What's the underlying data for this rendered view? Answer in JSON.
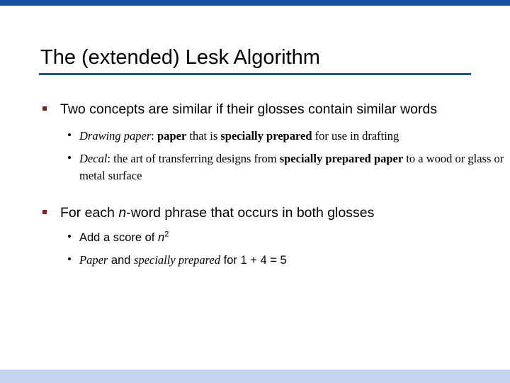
{
  "slide": {
    "title": "The (extended) Lesk Algorithm",
    "accent_color": "#14509E",
    "rule_color": "#1F5287",
    "bullet_marker_color": "#7B2222",
    "footer_band_color": "#C5D5EF"
  },
  "bullets": {
    "b1": {
      "text": "Two concepts are similar if their glosses contain similar words"
    },
    "b1_sub1": {
      "term": "Drawing paper",
      "colon": ": ",
      "bold1": "paper",
      "mid1": " that is ",
      "bold2": "specially prepared",
      "tail": " for use in drafting"
    },
    "b1_sub2": {
      "term": "Decal",
      "colon": ": ",
      "mid1": "the art of transferring designs from ",
      "bold1": "specially prepared paper",
      "tail": " to a wood or glass or metal surface"
    },
    "b2": {
      "pre": "For each ",
      "var": "n",
      "post": "-word phrase that occurs in both glosses"
    },
    "b2_sub1": {
      "pre": "Add a score of ",
      "var": "n",
      "exp": "2"
    },
    "b2_sub2": {
      "term1": "Paper",
      "mid1": " and ",
      "term2": "specially prepared",
      "tail": " for 1 + 4 = 5"
    }
  }
}
